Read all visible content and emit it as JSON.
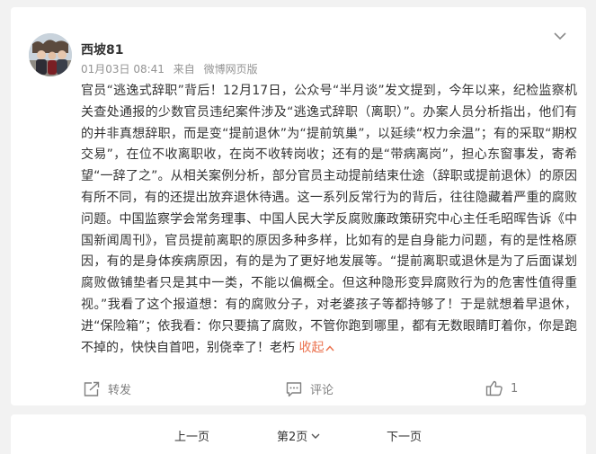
{
  "post": {
    "username": "西坡81",
    "timestamp": "01月03日 08:41",
    "source_prefix": "来自",
    "source": "微博网页版",
    "content": "官员“逃逸式辞职”背后！12月17日，公众号“半月谈”发文提到，今年以来，纪检监察机关查处通报的少数官员违纪案件涉及“逃逸式辞职（离职）”。办案人员分析指出，他们有的并非真想辞职，而是变“提前退休”为“提前筑巢”，以延续“权力余温”；有的采取“期权交易”，在位不收离职收，在岗不收转岗收；还有的是“带病离岗”，担心东窗事发，寄希望“一辞了之”。从相关案例分析，部分官员主动提前结束仕途（辞职或提前退休）的原因有所不同，有的还提出放弃退休待遇。这一系列反常行为的背后，往往隐藏着严重的腐败问题。中国监察学会常务理事、中国人民大学反腐败廉政策研究中心主任毛昭晖告诉《中国新闻周刊》，官员提前离职的原因多种多样，比如有的是自身能力问题，有的是性格原因，有的是身体疾病原因，有的是为了更好地发展等。“提前离职或退休是为了后面谋划腐败做铺垫者只是其中一类，不能以偏概全。但这种隐形变异腐败行为的危害性值得重视。”我看了这个报道想：有的腐败分子，对老婆孩子等都持够了！于是就想着早退休，进“保险箱”；依我看：你只要搞了腐败，不管你跑到哪里，都有无数眼睛盯着你，你是跑不掉的，快快自首吧，别侥幸了！老朽",
    "collapse_label": "收起"
  },
  "actions": {
    "repost_label": "转发",
    "comment_label": "评论",
    "like_count": "1"
  },
  "pagination": {
    "prev_label": "上一页",
    "current_page_label": "第2页",
    "next_label": "下一页"
  },
  "colors": {
    "accent": "#eb7350",
    "meta_text": "#939393",
    "body_text": "#333333",
    "background": "#f2f2f2"
  },
  "icons": {
    "post_menu": "chevron-down-icon",
    "repost": "repost-icon",
    "comment": "comment-icon",
    "like": "thumbs-up-icon",
    "collapse": "chevron-up-icon",
    "page_select": "chevron-down-icon"
  }
}
